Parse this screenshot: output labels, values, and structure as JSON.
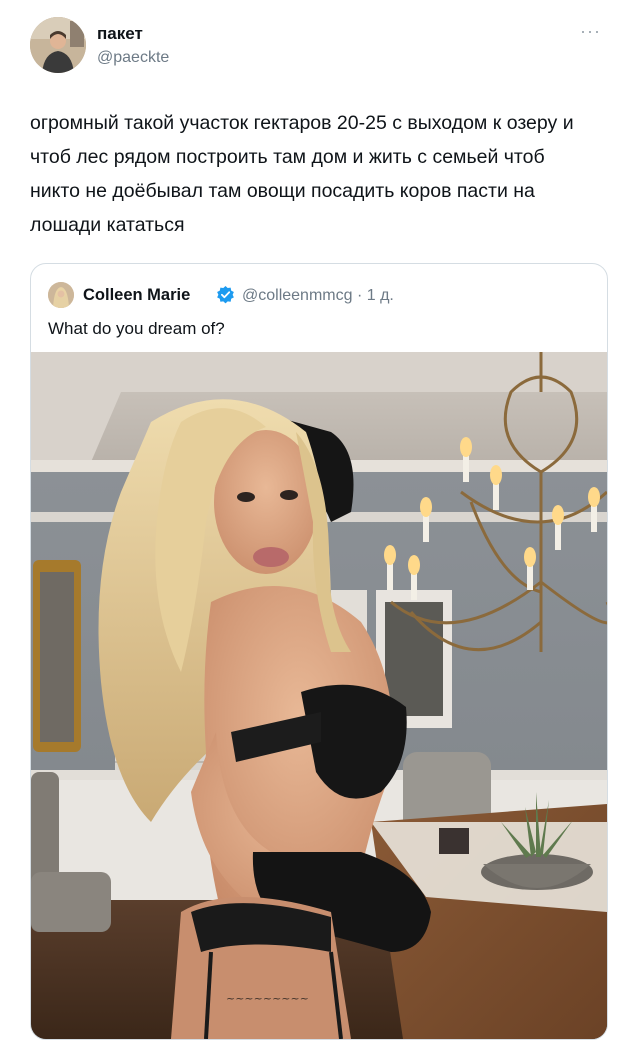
{
  "tweet": {
    "display_name": "пакет",
    "handle": "@paeckte",
    "text": "огромный такой участок гектаров 20-25 с выходом к озеру и чтоб лес рядом построить там дом и жить с семьей чтоб никто не доёбывал там овощи посадить коров пасти на лошади кататься",
    "more_icon": "more-icon"
  },
  "quoted": {
    "display_name": "Colleen Marie",
    "handle_time": "@colleenmmcg · 1 д.",
    "verified_color": "#1d9bf0",
    "text": "What do you dream of?",
    "media": "photo"
  },
  "colors": {
    "text": "#0f1419",
    "secondary": "#6d7a86",
    "border": "#d5dde3"
  }
}
